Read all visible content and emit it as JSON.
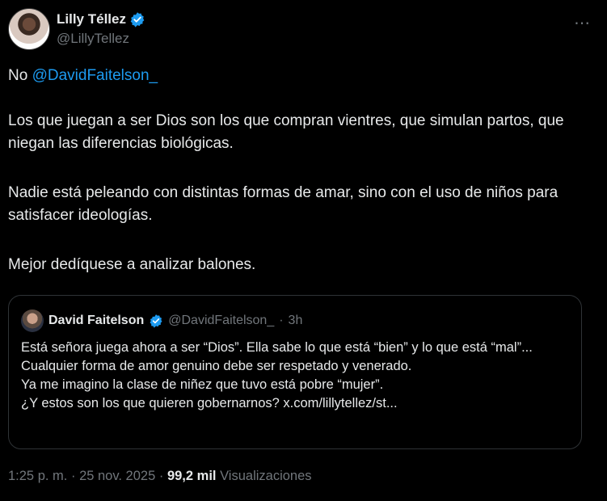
{
  "author": {
    "display_name": "Lilly Téllez",
    "handle": "@LillyTellez",
    "verified": true
  },
  "more_icon": "⋯",
  "tweet": {
    "lines": [
      {
        "prefix": "No ",
        "mention": "@DavidFaitelson_"
      },
      {
        "text": "Los que juegan a ser Dios son los que compran vientres, que simulan partos, que niegan las diferencias biológicas."
      },
      {
        "text": "Nadie está peleando con distintas formas de amar, sino con el uso de niños para satisfacer ideologías."
      },
      {
        "text": "Mejor dedíquese a analizar balones."
      }
    ]
  },
  "quote": {
    "display_name": "David Faitelson",
    "handle": "@DavidFaitelson_",
    "separator": "·",
    "time": "3h",
    "lines": [
      "Está señora juega ahora a ser “Dios”. Ella sabe lo que está “bien” y lo que está “mal”...",
      "Cualquier forma de amor genuino debe ser respetado y venerado.",
      "Ya me imagino la clase de niñez que tuvo está pobre “mujer”.",
      "¿Y estos son los que quieren gobernarnos? x.com/lillytellez/st..."
    ]
  },
  "meta": {
    "time": "1:25 p. m.",
    "sep1": "·",
    "date": "25 nov. 2025",
    "sep2": "·",
    "views_count": "99,2 mil",
    "views_label": "Visualizaciones"
  },
  "colors": {
    "background": "#000000",
    "text": "#e7e9ea",
    "muted": "#71767b",
    "link": "#1d9bf0",
    "verified": "#1d9bf0"
  }
}
